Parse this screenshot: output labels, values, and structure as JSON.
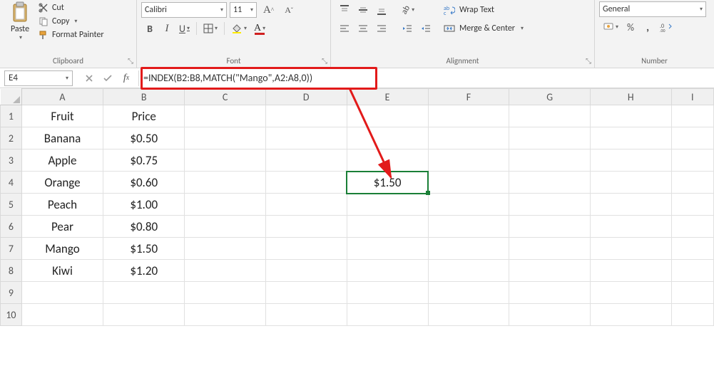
{
  "ribbon": {
    "clipboard": {
      "paste": "Paste",
      "cut": "Cut",
      "copy": "Copy",
      "format_painter": "Format Painter",
      "group_label": "Clipboard"
    },
    "font": {
      "font_name": "Calibri",
      "font_size": "11",
      "bold": "B",
      "italic": "I",
      "underline": "U",
      "increase": "A",
      "decrease": "A",
      "color_letter": "A",
      "group_label": "Font"
    },
    "alignment": {
      "wrap_text": "Wrap Text",
      "merge_center": "Merge & Center",
      "group_label": "Alignment"
    },
    "number": {
      "format": "General",
      "percent": "%",
      "comma": ",",
      "group_label": "Number"
    }
  },
  "formula_bar": {
    "cell_ref": "E4",
    "formula": "=INDEX(B2:B8,MATCH(\"Mango\",A2:A8,0))"
  },
  "columns": [
    "A",
    "B",
    "C",
    "D",
    "E",
    "F",
    "G",
    "H",
    "I"
  ],
  "rows": [
    "1",
    "2",
    "3",
    "4",
    "5",
    "6",
    "7",
    "8",
    "9",
    "10"
  ],
  "cells": {
    "A1": "Fruit",
    "B1": "Price",
    "A2": "Banana",
    "B2": "$0.50",
    "A3": "Apple",
    "B3": "$0.75",
    "A4": "Orange",
    "B4": "$0.60",
    "A5": "Peach",
    "B5": "$1.00",
    "A6": "Pear",
    "B6": "$0.80",
    "A7": "Mango",
    "B7": "$1.50",
    "A8": "Kiwi",
    "B8": "$1.20",
    "E4": "$1.50"
  },
  "selected_cell": "E4"
}
